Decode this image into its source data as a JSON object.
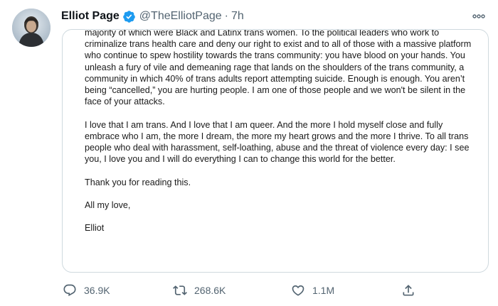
{
  "author": {
    "display_name": "Elliot Page",
    "handle": "@TheElliotPage",
    "separator": "·",
    "time": "7h",
    "verified": true
  },
  "icons": {
    "more": "more-horizontal-icon",
    "verified": "verified-badge-icon",
    "reply": "reply-icon",
    "retweet": "retweet-icon",
    "like": "heart-icon",
    "share": "share-icon"
  },
  "colors": {
    "verified_blue": "#1d9bf0",
    "muted_text": "#536471",
    "border": "#cfd9de"
  },
  "letter": {
    "paragraphs": [
      "majority of which were Black and Latinx trans women. To the political leaders who work to criminalize trans health care and deny our right to exist and to all of those with a massive platform who continue to spew hostility towards the trans community: you have blood on your hands. You unleash a fury of vile and demeaning rage that lands on the shoulders of the trans community, a community in which 40% of trans adults report attempting suicide. Enough is enough. You aren’t being “cancelled,” you are hurting people. I am one of those people and we won't be silent in the face of your attacks.",
      "I love that I am trans. And I love that I am queer. And the more I hold myself close and fully embrace who I am, the more I dream, the more my heart grows and the more I thrive. To all trans people who deal with harassment, self-loathing, abuse and the threat of violence every day: I see you, I love you and I will do everything I can to change this world for the better.",
      "Thank you for reading this.",
      "All my love,",
      "Elliot"
    ]
  },
  "actions": {
    "reply_count": "36.9K",
    "retweet_count": "268.6K",
    "like_count": "1.1M"
  }
}
